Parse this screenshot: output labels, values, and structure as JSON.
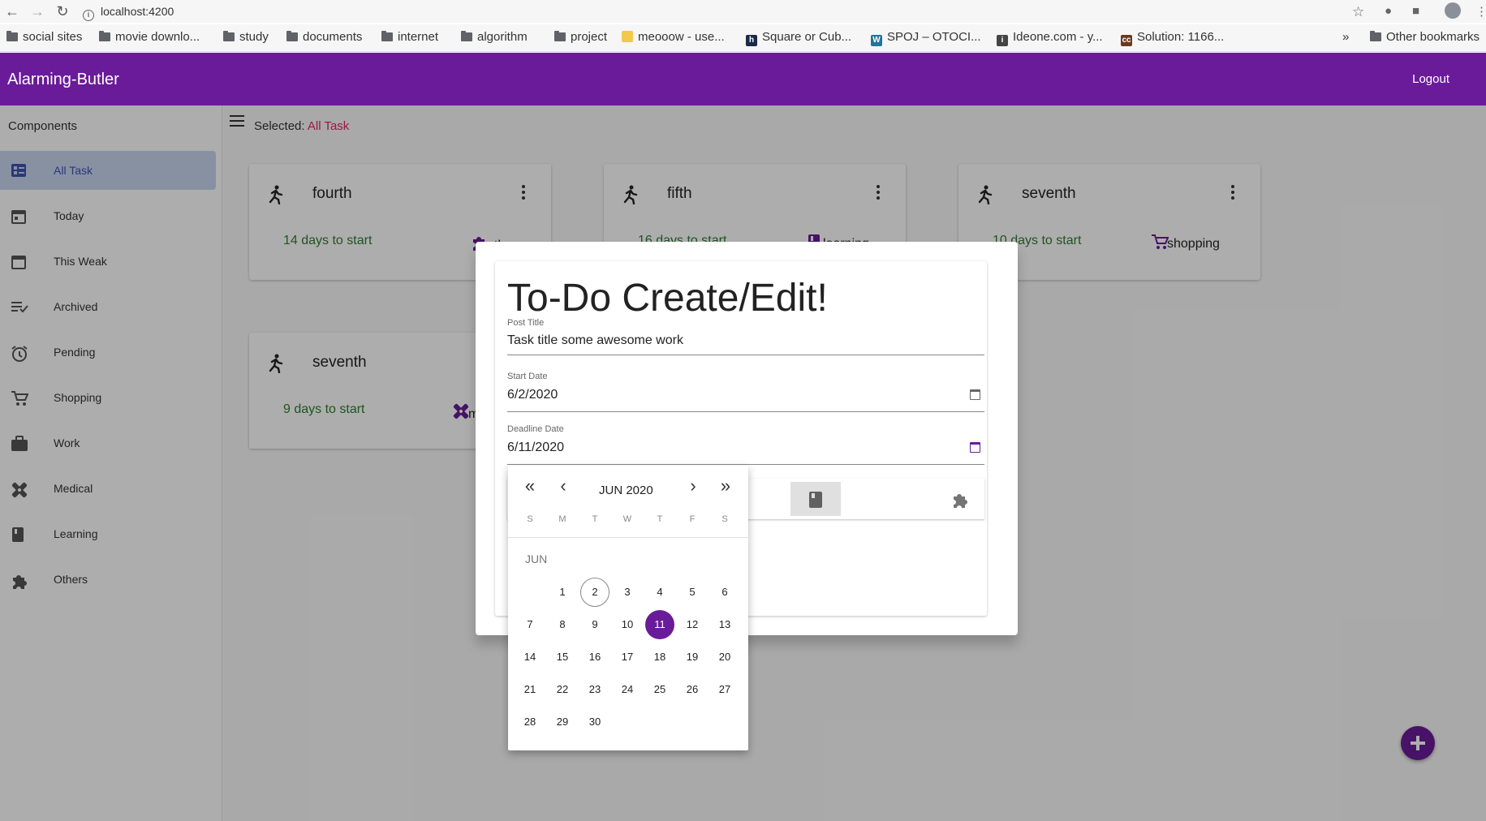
{
  "browser": {
    "url": "localhost:4200",
    "bookmarks": [
      {
        "label": "social sites",
        "kind": "folder"
      },
      {
        "label": "movie downlo...",
        "kind": "folder"
      },
      {
        "label": "study",
        "kind": "folder"
      },
      {
        "label": "documents",
        "kind": "folder"
      },
      {
        "label": "internet",
        "kind": "folder"
      },
      {
        "label": "algorithm",
        "kind": "folder"
      },
      {
        "label": "project",
        "kind": "folder"
      },
      {
        "label": "meooow - use...",
        "kind": "site",
        "color": "#f2c94c"
      },
      {
        "label": "Square or Cub...",
        "kind": "site",
        "color": "#1a2a4a",
        "glyph": "h"
      },
      {
        "label": "SPOJ – OTOCI...",
        "kind": "site",
        "color": "#21759b",
        "glyph": "W"
      },
      {
        "label": "Ideone.com - y...",
        "kind": "site",
        "color": "#444444",
        "glyph": "i"
      },
      {
        "label": "Solution: 1166...",
        "kind": "site",
        "color": "#6b3a1e",
        "glyph": "cc"
      }
    ],
    "overflow": "»",
    "other_bookmarks": "Other bookmarks"
  },
  "app": {
    "title": "Alarming-Butler",
    "logout": "Logout",
    "accent": "#6a1b9a"
  },
  "sidebar": {
    "title": "Components",
    "items": [
      {
        "label": "All Task",
        "icon": "list-icon",
        "active": true
      },
      {
        "label": "Today",
        "icon": "calendar-today-icon"
      },
      {
        "label": "This Weak",
        "icon": "calendar-week-icon"
      },
      {
        "label": "Archived",
        "icon": "playlist-check-icon"
      },
      {
        "label": "Pending",
        "icon": "alarm-icon"
      },
      {
        "label": "Shopping",
        "icon": "cart-icon"
      },
      {
        "label": "Work",
        "icon": "briefcase-icon"
      },
      {
        "label": "Medical",
        "icon": "bandage-icon"
      },
      {
        "label": "Learning",
        "icon": "book-icon"
      },
      {
        "label": "Others",
        "icon": "puzzle-icon"
      }
    ]
  },
  "main": {
    "selected_prefix": "Selected:",
    "selected_value": "All Task",
    "cards": [
      {
        "title": "fourth",
        "days": "14 days to start",
        "category": "other",
        "cat_icon": "puzzle-icon"
      },
      {
        "title": "fifth",
        "days": "16 days to start",
        "category": "learning",
        "cat_icon": "book-icon"
      },
      {
        "title": "seventh",
        "days": "10 days to start",
        "category": "shopping",
        "cat_icon": "cart-icon"
      },
      {
        "title": "seventh",
        "days": "9 days to start",
        "category": "medical",
        "cat_icon": "bandage-icon"
      }
    ]
  },
  "dialog": {
    "title": "To-Do Create/Edit!",
    "post_title_label": "Post Title",
    "post_title_value": "Task title some awesome work",
    "start_label": "Start Date",
    "start_value": "6/2/2020",
    "deadline_label": "Deadline Date",
    "deadline_value": "6/11/2020",
    "category_selected": "learning"
  },
  "datepicker": {
    "month_label": "JUN 2020",
    "section_label": "JUN",
    "weekdays": [
      "S",
      "M",
      "T",
      "W",
      "T",
      "F",
      "S"
    ],
    "first_weekday": 1,
    "days_in_month": 30,
    "today": 2,
    "selected": 11
  }
}
